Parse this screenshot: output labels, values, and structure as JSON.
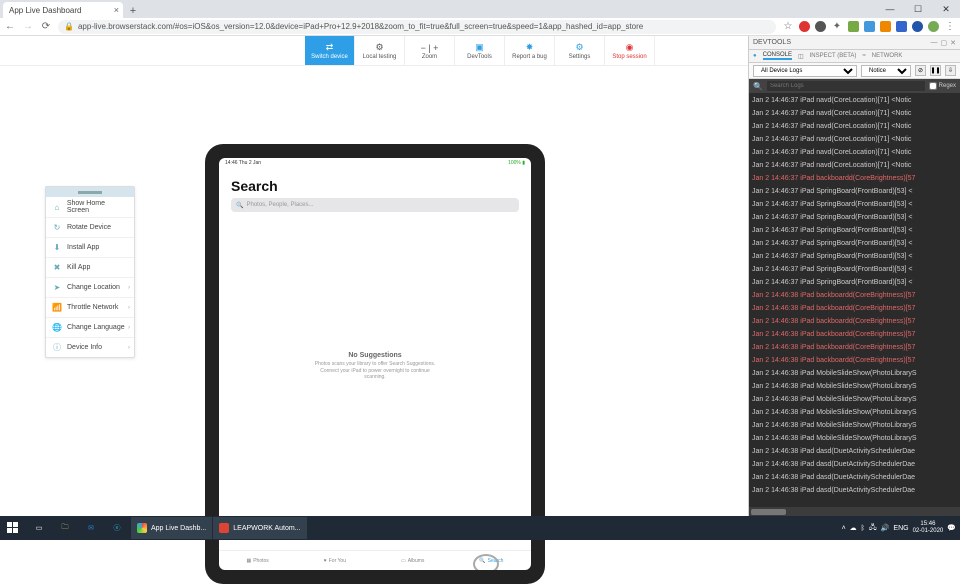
{
  "browser": {
    "tab_title": "App Live Dashboard",
    "url": "app-live.browserstack.com/#os=iOS&os_version=12.0&device=iPad+Pro+12.9+2018&zoom_to_fit=true&full_screen=true&speed=1&app_hashed_id=app_store",
    "win_min": "—",
    "win_max": "☐",
    "win_close": "✕"
  },
  "toolbar": {
    "switch": "Switch device",
    "local": "Local testing",
    "zoom": "Zoom",
    "devtools": "DevTools",
    "report": "Report a bug",
    "settings": "Settings",
    "stop": "Stop session",
    "zoom_icons": "−  |  +"
  },
  "sidebar": {
    "items": [
      {
        "label": "Show Home Screen",
        "icon": "⌂",
        "chev": false
      },
      {
        "label": "Rotate Device",
        "icon": "↻",
        "chev": false
      },
      {
        "label": "Install App",
        "icon": "⬇",
        "chev": false
      },
      {
        "label": "Kill App",
        "icon": "✖",
        "chev": false
      },
      {
        "label": "Change Location",
        "icon": "➤",
        "chev": true
      },
      {
        "label": "Throttle Network",
        "icon": "📶",
        "chev": true
      },
      {
        "label": "Change Language",
        "icon": "🌐",
        "chev": true
      },
      {
        "label": "Device Info",
        "icon": "ⓘ",
        "chev": true
      }
    ]
  },
  "ipad": {
    "status_left": "14:46  Thu 2 Jan",
    "status_right": "100% ▮",
    "title": "Search",
    "placeholder": "Photos, People, Places...",
    "nosugg_title": "No Suggestions",
    "nosugg_line1": "Photos scans your library to offer Search Suggestions.",
    "nosugg_line2": "Connect your iPad to power overnight to continue",
    "nosugg_line3": "scanning.",
    "tabs": {
      "photos": "Photos",
      "foryou": "For You",
      "albums": "Albums",
      "search": "Search"
    }
  },
  "devtools": {
    "title": "DEVTOOLS",
    "tabs": {
      "console": "CONSOLE",
      "inspect": "INSPECT (BETA)",
      "network": "NETWORK"
    },
    "filter_device": "All Device Logs",
    "filter_level": "Notice",
    "search_ph": "Search Logs",
    "regex": "Regex",
    "logs": [
      {
        "t": "Jan  2 14:46:37 iPad navd(CoreLocation)[71] <Notic",
        "err": false
      },
      {
        "t": "Jan  2 14:46:37 iPad navd(CoreLocation)[71] <Notic",
        "err": false
      },
      {
        "t": "Jan  2 14:46:37 iPad navd(CoreLocation)[71] <Notic",
        "err": false
      },
      {
        "t": "Jan  2 14:46:37 iPad navd(CoreLocation)[71] <Notic",
        "err": false
      },
      {
        "t": "Jan  2 14:46:37 iPad navd(CoreLocation)[71] <Notic",
        "err": false
      },
      {
        "t": "Jan  2 14:46:37 iPad navd(CoreLocation)[71] <Notic",
        "err": false
      },
      {
        "t": "Jan  2 14:46:37 iPad backboardd(CoreBrightness)[57",
        "err": true
      },
      {
        "t": "Jan  2 14:46:37 iPad SpringBoard(FrontBoard)[53] <",
        "err": false
      },
      {
        "t": "Jan  2 14:46:37 iPad SpringBoard(FrontBoard)[53] <",
        "err": false
      },
      {
        "t": "Jan  2 14:46:37 iPad SpringBoard(FrontBoard)[53] <",
        "err": false
      },
      {
        "t": "Jan  2 14:46:37 iPad SpringBoard(FrontBoard)[53] <",
        "err": false
      },
      {
        "t": "Jan  2 14:46:37 iPad SpringBoard(FrontBoard)[53] <",
        "err": false
      },
      {
        "t": "Jan  2 14:46:37 iPad SpringBoard(FrontBoard)[53] <",
        "err": false
      },
      {
        "t": "Jan  2 14:46:37 iPad SpringBoard(FrontBoard)[53] <",
        "err": false
      },
      {
        "t": "Jan  2 14:46:37 iPad SpringBoard(FrontBoard)[53] <",
        "err": false
      },
      {
        "t": "Jan  2 14:46:38 iPad backboardd(CoreBrightness)[57",
        "err": true
      },
      {
        "t": "Jan  2 14:46:38 iPad backboardd(CoreBrightness)[57",
        "err": true
      },
      {
        "t": "Jan  2 14:46:38 iPad backboardd(CoreBrightness)[57",
        "err": true
      },
      {
        "t": "Jan  2 14:46:38 iPad backboardd(CoreBrightness)[57",
        "err": true
      },
      {
        "t": "Jan  2 14:46:38 iPad backboardd(CoreBrightness)[57",
        "err": true
      },
      {
        "t": "Jan  2 14:46:38 iPad backboardd(CoreBrightness)[57",
        "err": true
      },
      {
        "t": "Jan  2 14:46:38 iPad MobileSlideShow(PhotoLibraryS",
        "err": false
      },
      {
        "t": "Jan  2 14:46:38 iPad MobileSlideShow(PhotoLibraryS",
        "err": false
      },
      {
        "t": "Jan  2 14:46:38 iPad MobileSlideShow(PhotoLibraryS",
        "err": false
      },
      {
        "t": "Jan  2 14:46:38 iPad MobileSlideShow(PhotoLibraryS",
        "err": false
      },
      {
        "t": "Jan  2 14:46:38 iPad MobileSlideShow(PhotoLibraryS",
        "err": false
      },
      {
        "t": "Jan  2 14:46:38 iPad MobileSlideShow(PhotoLibraryS",
        "err": false
      },
      {
        "t": "Jan  2 14:46:38 iPad dasd(DuetActivitySchedulerDae",
        "err": false
      },
      {
        "t": "Jan  2 14:46:38 iPad dasd(DuetActivitySchedulerDae",
        "err": false
      },
      {
        "t": "Jan  2 14:46:38 iPad dasd(DuetActivitySchedulerDae",
        "err": false
      },
      {
        "t": "Jan  2 14:46:38 iPad dasd(DuetActivitySchedulerDae",
        "err": false
      }
    ]
  },
  "taskbar": {
    "apps": [
      {
        "label": "App Live Dashb...",
        "color": "#e24"
      },
      {
        "label": "LEAPWORK Autom...",
        "color": "#d43"
      }
    ],
    "lang": "ENG",
    "time": "15:46",
    "date": "02-01-2020"
  }
}
